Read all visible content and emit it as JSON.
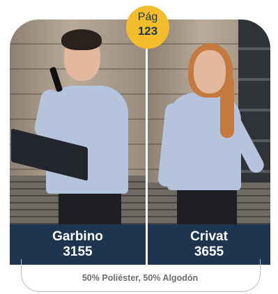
{
  "badge": {
    "label": "Pág",
    "number": "123"
  },
  "products": [
    {
      "name": "Garbino",
      "code": "3155"
    },
    {
      "name": "Crivat",
      "code": "3655"
    }
  ],
  "material": "50% Poliéster, 50% Algodón",
  "colors": {
    "navy": "#1e3550",
    "badge_yellow": "#f3bd2d",
    "shirt_blue": "#b6c3dc"
  }
}
